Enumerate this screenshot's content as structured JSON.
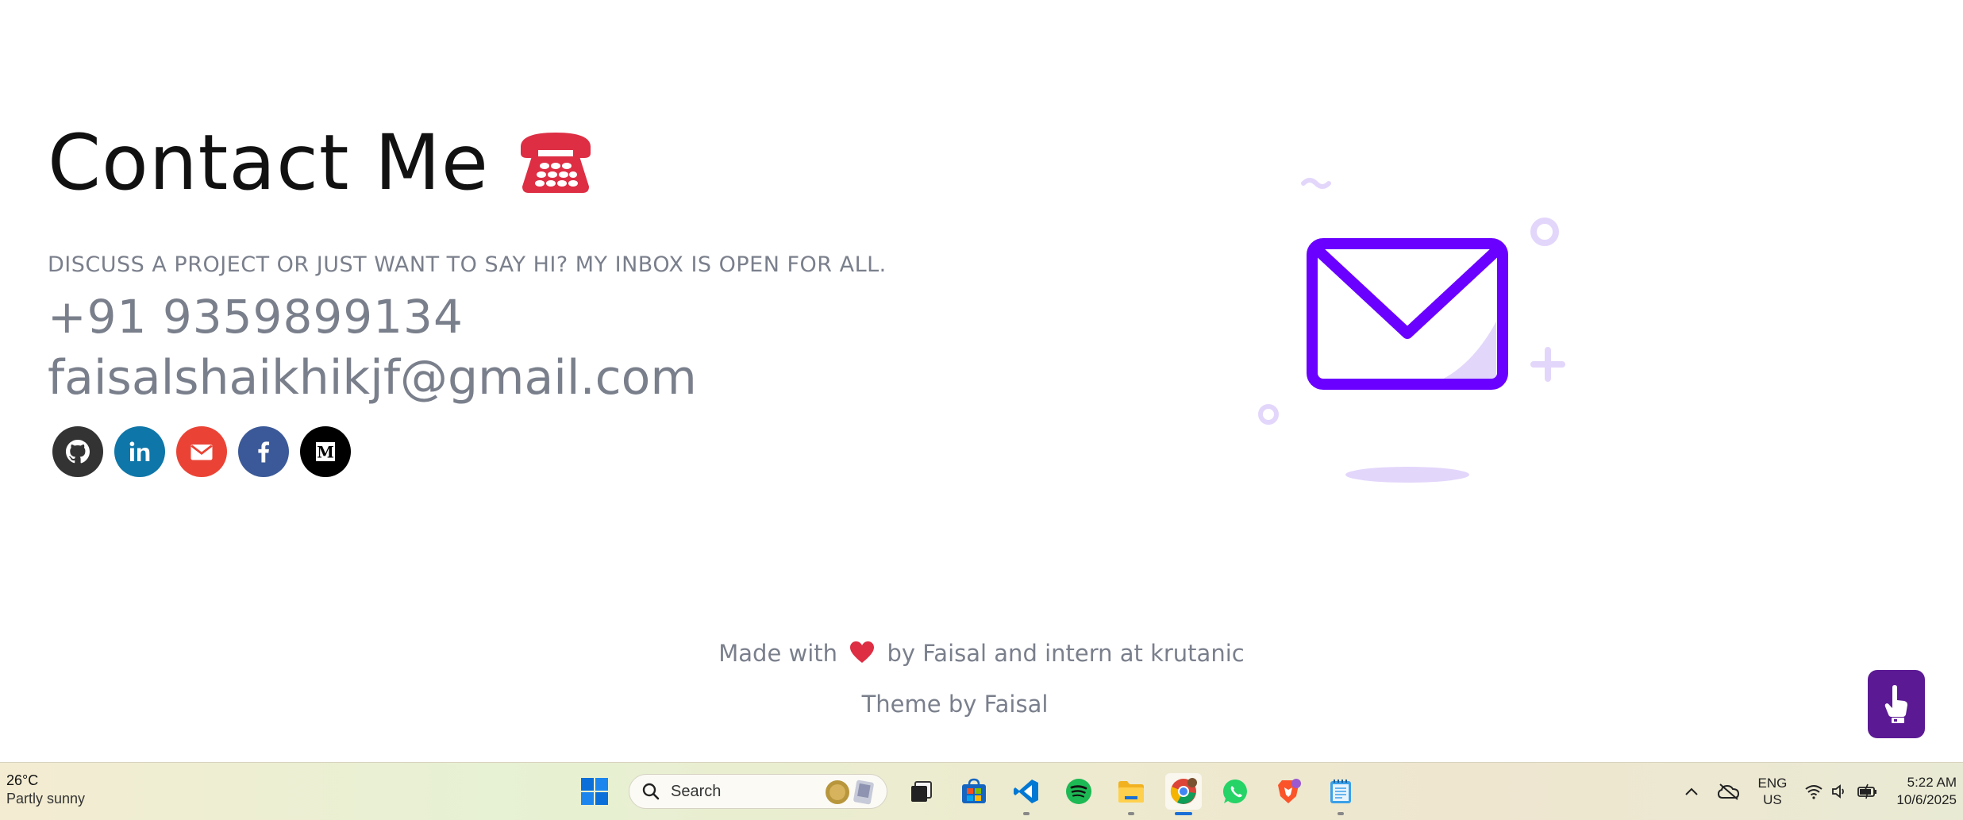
{
  "contact": {
    "title": "Contact Me",
    "phone_emoji_icon": "telephone-icon",
    "subtitle": "DISCUSS A PROJECT OR JUST WANT TO SAY HI? MY INBOX IS OPEN FOR ALL.",
    "phone": "+91 9359899134",
    "email": "faisalshaikhikjf@gmail.com",
    "socials": [
      {
        "name": "github",
        "icon": "github-icon",
        "color": "#333333"
      },
      {
        "name": "linkedin",
        "icon": "linkedin-icon",
        "color": "#0e76a8"
      },
      {
        "name": "gmail",
        "icon": "envelope-icon",
        "color": "#ea4335"
      },
      {
        "name": "facebook",
        "icon": "facebook-icon",
        "color": "#3b5998"
      },
      {
        "name": "medium",
        "icon": "medium-icon",
        "color": "#000000"
      }
    ]
  },
  "illustration": {
    "icon": "mail-envelope-icon",
    "accent": "#6a00ff",
    "soft": "#e3d6fb"
  },
  "footer": {
    "made_prefix": "Made with",
    "made_suffix": "by Faisal and intern at krutanic",
    "theme": "Theme by Faisal"
  },
  "fab": {
    "icon": "pointing-hand-icon",
    "color": "#5b1a94"
  },
  "taskbar": {
    "weather_temp": "26°C",
    "weather_cond": "Partly sunny",
    "search_label": "Search",
    "apps": [
      "start-icon",
      "search",
      "task-view-icon",
      "store-icon",
      "vscode-icon",
      "spotify-icon",
      "file-explorer-icon",
      "chrome-icon",
      "whatsapp-icon",
      "brave-icon",
      "notepad-icon"
    ],
    "lang_top": "ENG",
    "lang_bottom": "US",
    "time": "5:22 AM",
    "date": "10/6/2025"
  }
}
